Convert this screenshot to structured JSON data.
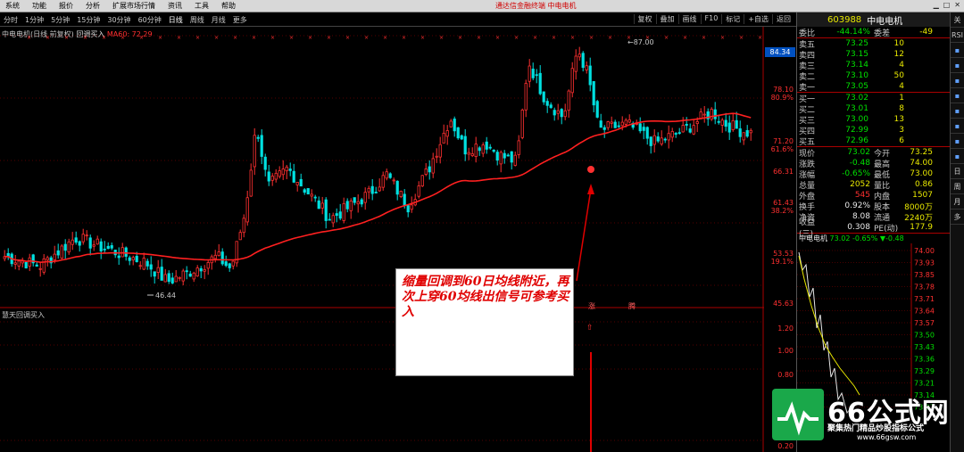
{
  "app": {
    "menu": [
      "系统",
      "功能",
      "报价",
      "分析",
      "扩展市场行情",
      "资讯",
      "工具",
      "帮助"
    ],
    "title": "通达信金融终端   中电电机"
  },
  "toolbar": {
    "periods": [
      "分时",
      "1分钟",
      "5分钟",
      "15分钟",
      "30分钟",
      "60分钟",
      "日线",
      "周线",
      "月线",
      "更多"
    ],
    "active": "日线",
    "right_buttons": [
      "复权",
      "叠加",
      "画线",
      "F10",
      "标记",
      "+自选",
      "返回"
    ]
  },
  "chart_header": {
    "name": "中电电机(日线 前复权)",
    "indicator": "回调买入",
    "ma_label": "MA60: 72.29"
  },
  "indicator_label": "慧天回调买入",
  "y_axis": {
    "ticks": [
      "84.34",
      "78.10",
      "71.20",
      "66.31",
      "61.43",
      "53.53",
      "45.63"
    ],
    "pcts": [
      "80.9%",
      "61.6%",
      "38.2%",
      "19.1%"
    ],
    "sub_ticks": [
      "1.20",
      "1.00",
      "0.80",
      "0.20"
    ]
  },
  "annotations": {
    "high_label": "87.00",
    "low_label": "46.44",
    "text": "缩量回调到60日均线附近，再次上穿60均线出信号可参考买入",
    "markers": [
      "涨",
      "腾"
    ]
  },
  "quote": {
    "code": "603988",
    "name": "中电电机",
    "weibi": "-44.14%",
    "weicha_label": "委差",
    "weicha": "-49",
    "sell": [
      {
        "label": "卖五",
        "price": "73.25",
        "vol": "10"
      },
      {
        "label": "卖四",
        "price": "73.15",
        "vol": "12"
      },
      {
        "label": "卖三",
        "price": "73.14",
        "vol": "4"
      },
      {
        "label": "卖二",
        "price": "73.10",
        "vol": "50"
      },
      {
        "label": "卖一",
        "price": "73.05",
        "vol": "4"
      }
    ],
    "buy": [
      {
        "label": "买一",
        "price": "73.02",
        "vol": "1"
      },
      {
        "label": "买二",
        "price": "73.01",
        "vol": "8"
      },
      {
        "label": "买三",
        "price": "73.00",
        "vol": "13"
      },
      {
        "label": "买四",
        "price": "72.99",
        "vol": "3"
      },
      {
        "label": "买五",
        "price": "72.96",
        "vol": "6"
      }
    ],
    "stats": [
      {
        "l1": "现价",
        "v1": "73.02",
        "l2": "今开",
        "v2": "73.25"
      },
      {
        "l1": "涨跌",
        "v1": "-0.48",
        "l2": "最高",
        "v2": "74.00"
      },
      {
        "l1": "涨幅",
        "v1": "-0.65%",
        "l2": "最低",
        "v2": "73.00"
      },
      {
        "l1": "总量",
        "v1": "2052",
        "l2": "量比",
        "v2": "0.86"
      },
      {
        "l1": "外盘",
        "v1": "545",
        "l2": "内盘",
        "v2": "1507"
      },
      {
        "l1": "换手",
        "v1": "0.92%",
        "l2": "股本",
        "v2": "8000万"
      },
      {
        "l1": "净资",
        "v1": "8.08",
        "l2": "流通",
        "v2": "2240万"
      },
      {
        "l1": "收益(三)",
        "v1": "0.308",
        "l2": "PE(动)",
        "v2": "177.9"
      }
    ],
    "mini_header": {
      "name": "中电电机",
      "price": "73.02",
      "chg": "-0.65%",
      "diff": "▼-0.48"
    },
    "mini_ticks": [
      "74.00",
      "73.93",
      "73.85",
      "73.78",
      "73.71",
      "73.64",
      "73.57",
      "73.50",
      "73.43",
      "73.36",
      "73.29",
      "73.21",
      "73.14",
      "73.07"
    ]
  },
  "side_tabs": [
    "关",
    "RSI",
    "",
    "",
    "",
    "",
    "",
    "",
    "",
    "",
    "日",
    "周",
    "月",
    "多"
  ],
  "watermark": {
    "big": "66公式网",
    "sub": "聚集热门精品炒股指标公式",
    "url": "www.66gsw.com"
  },
  "colors": {
    "up": "#ff3030",
    "down": "#00e0e0",
    "ma": "#ff2020"
  }
}
